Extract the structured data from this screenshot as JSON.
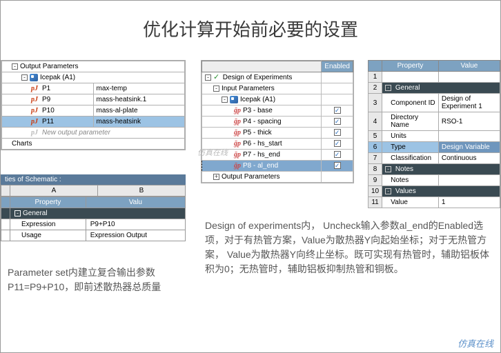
{
  "title": "优化计算开始前必要的设置",
  "output_panel": {
    "header": "Output Parameters",
    "group": "Icepak (A1)",
    "rows": [
      {
        "name": "P1",
        "val": "max-temp"
      },
      {
        "name": "P9",
        "val": "mass-heatsink.1"
      },
      {
        "name": "P10",
        "val": "mass-al-plate"
      },
      {
        "name": "P11",
        "val": "mass-heatsink",
        "selected": true
      }
    ],
    "new_row": "New output parameter",
    "charts": "Charts"
  },
  "schematic": {
    "title": "ties of Schematic :",
    "col_a": "A",
    "col_b": "B",
    "prop_h": "Property",
    "val_h": "Valu",
    "section": "General",
    "rows": [
      {
        "p": "Expression",
        "v": "P9+P10"
      },
      {
        "p": "Usage",
        "v": "Expression Output"
      }
    ]
  },
  "para_left": "Parameter set内建立复合输出参数 P11=P9+P10，即前述散热器总质量",
  "doe": {
    "enabled_h": "Enabled",
    "root": "Design of Experiments",
    "inp": "Input Parameters",
    "group": "Icepak (A1)",
    "params": [
      {
        "label": "P3 - base",
        "ck": true
      },
      {
        "label": "P4 - spacing",
        "ck": true
      },
      {
        "label": "P5 - thick",
        "ck": true
      },
      {
        "label": "P6 - hs_start",
        "ck": true
      },
      {
        "label": "P7 - hs_end",
        "ck": true
      },
      {
        "label": "P8 - al_end",
        "ck": true,
        "hl": true
      }
    ],
    "out": "Output Parameters"
  },
  "props": {
    "prop_h": "Property",
    "val_h": "Value",
    "rows": [
      {
        "n": "1",
        "type": "num"
      },
      {
        "n": "2",
        "type": "sec",
        "label": "General"
      },
      {
        "n": "3",
        "type": "kv",
        "p": "Component ID",
        "v": "Design of Experiment 1"
      },
      {
        "n": "4",
        "type": "kv",
        "p": "Directory Name",
        "v": "RSO-1"
      },
      {
        "n": "5",
        "type": "kv",
        "p": "Units",
        "v": ""
      },
      {
        "n": "6",
        "type": "kv",
        "p": "Type",
        "v": "Design Variable",
        "sel": true
      },
      {
        "n": "7",
        "type": "kv",
        "p": "Classification",
        "v": "Continuous"
      },
      {
        "n": "8",
        "type": "sec",
        "label": "Notes"
      },
      {
        "n": "9",
        "type": "kv",
        "p": "Notes",
        "v": ""
      },
      {
        "n": "10",
        "type": "sec",
        "label": "Values"
      },
      {
        "n": "11",
        "type": "kv",
        "p": "Value",
        "v": "1"
      }
    ]
  },
  "para_right": "Design of experiments内， Uncheck输入参数al_end的Enabled选项，对于有热管方案，Value为散热器Y向起始坐标；对于无热管方案， Value为散热器Y向终止坐标。既可实现有热管时，辅助铝板体积为0；无热管时，辅助铝板抑制热管和铜板。",
  "watermark": "仿真在线",
  "wm_mid": "仿真在线"
}
